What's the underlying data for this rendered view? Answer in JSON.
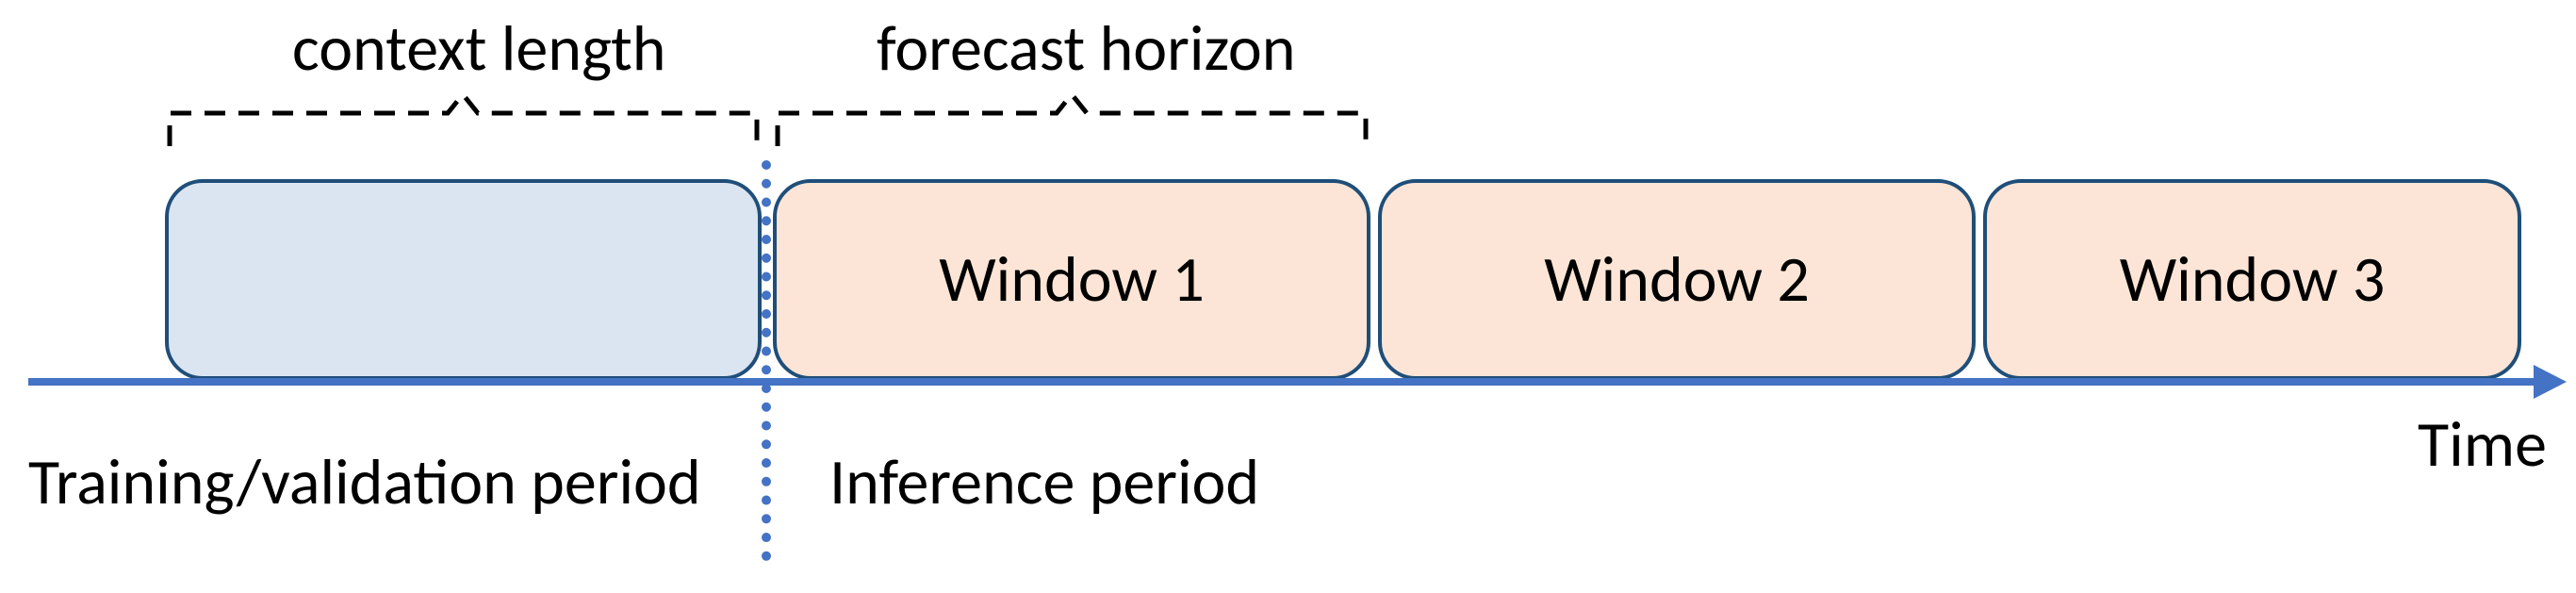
{
  "labels": {
    "context_length": "context length",
    "forecast_horizon": "forecast horizon",
    "training_period": "Training/validation period",
    "inference_period": "Inference period",
    "time_axis": "Time"
  },
  "windows": {
    "context": "",
    "w1": "Window 1",
    "w2": "Window 2",
    "w3": "Window 3"
  },
  "colors": {
    "context_fill": "#dbe5f1",
    "window_fill": "#fce5d6",
    "box_border": "#1f4e79",
    "axis": "#4472c4",
    "separator": "#4472c4"
  }
}
